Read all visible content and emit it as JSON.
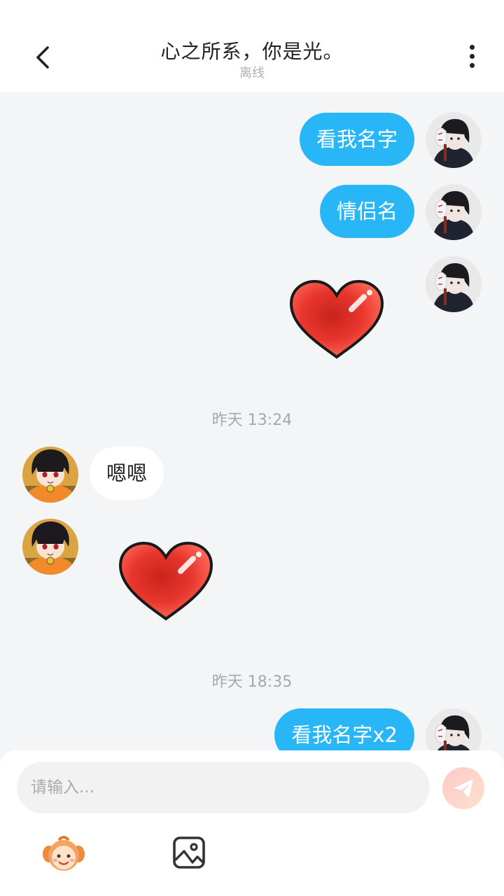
{
  "header": {
    "title": "心之所系，你是光。",
    "status": "离线"
  },
  "messages": [
    {
      "type": "text",
      "direction": "out",
      "text": "看我名字"
    },
    {
      "type": "text",
      "direction": "out",
      "text": "情侣名"
    },
    {
      "type": "sticker",
      "direction": "out",
      "sticker": "heart"
    },
    {
      "type": "timestamp",
      "text": "昨天 13:24"
    },
    {
      "type": "text",
      "direction": "in",
      "text": "嗯嗯"
    },
    {
      "type": "sticker",
      "direction": "in",
      "sticker": "heart"
    },
    {
      "type": "timestamp",
      "text": "昨天 18:35"
    },
    {
      "type": "text",
      "direction": "out",
      "text": "看我名字x2"
    }
  ],
  "composer": {
    "placeholder": "请输入...",
    "send_icon": "send-icon",
    "tools": [
      "emoji-icon",
      "image-icon"
    ]
  },
  "colors": {
    "outgoing_bubble": "#29b6f6",
    "incoming_bubble": "#ffffff",
    "background": "#f4f5f7",
    "heart": "#e8362d"
  }
}
